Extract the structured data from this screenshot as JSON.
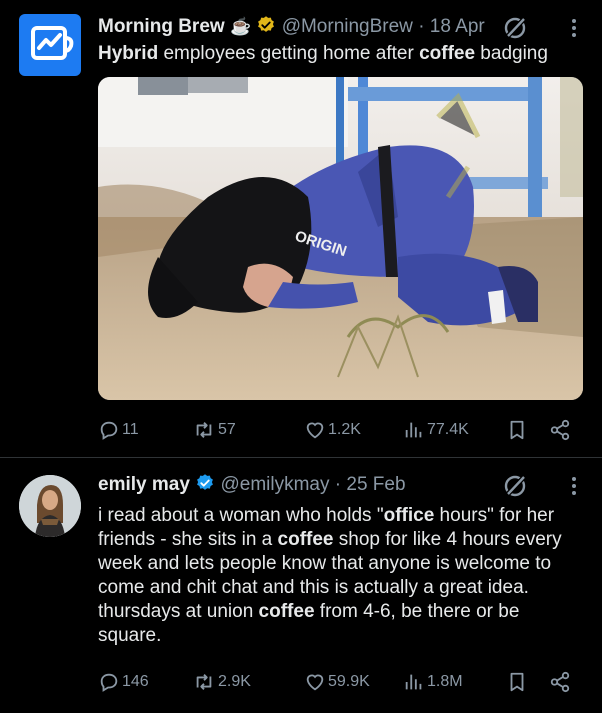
{
  "tweets": [
    {
      "name": "Morning Brew",
      "handle": "@MorningBrew",
      "sep": "·",
      "date": "18 Apr",
      "text_parts": [
        "Hybrid",
        " employees getting home after ",
        "coffee",
        " badging"
      ],
      "image_text": "ORIGIN",
      "stats": {
        "replies": "11",
        "retweets": "57",
        "likes": "1.2K",
        "views": "77.4K"
      }
    },
    {
      "name": "emily may",
      "handle": "@emilykmay",
      "sep": "·",
      "date": "25 Feb",
      "text_parts": [
        "i read about a woman who holds \"",
        "office",
        " hours\" for her friends - she sits in a ",
        "coffee",
        " shop for like 4 hours every week and lets people know that anyone is welcome to come and chit chat and this is actually a great idea. thursdays at union ",
        "coffee",
        " from 4-6, be there or be square."
      ],
      "stats": {
        "replies": "146",
        "retweets": "2.9K",
        "likes": "59.9K",
        "views": "1.8M"
      }
    }
  ],
  "colors": {
    "background": "#000000",
    "text": "#e7e9ea",
    "muted": "#8b98a5",
    "verified": "#1d9bf0",
    "brand": "#1d7bf2"
  },
  "icons": [
    "coffee-emoji-icon",
    "gold-verified-icon",
    "blue-verified-icon",
    "grok-icon",
    "more-icon",
    "reply-icon",
    "retweet-icon",
    "like-icon",
    "views-icon",
    "bookmark-icon",
    "share-icon"
  ]
}
